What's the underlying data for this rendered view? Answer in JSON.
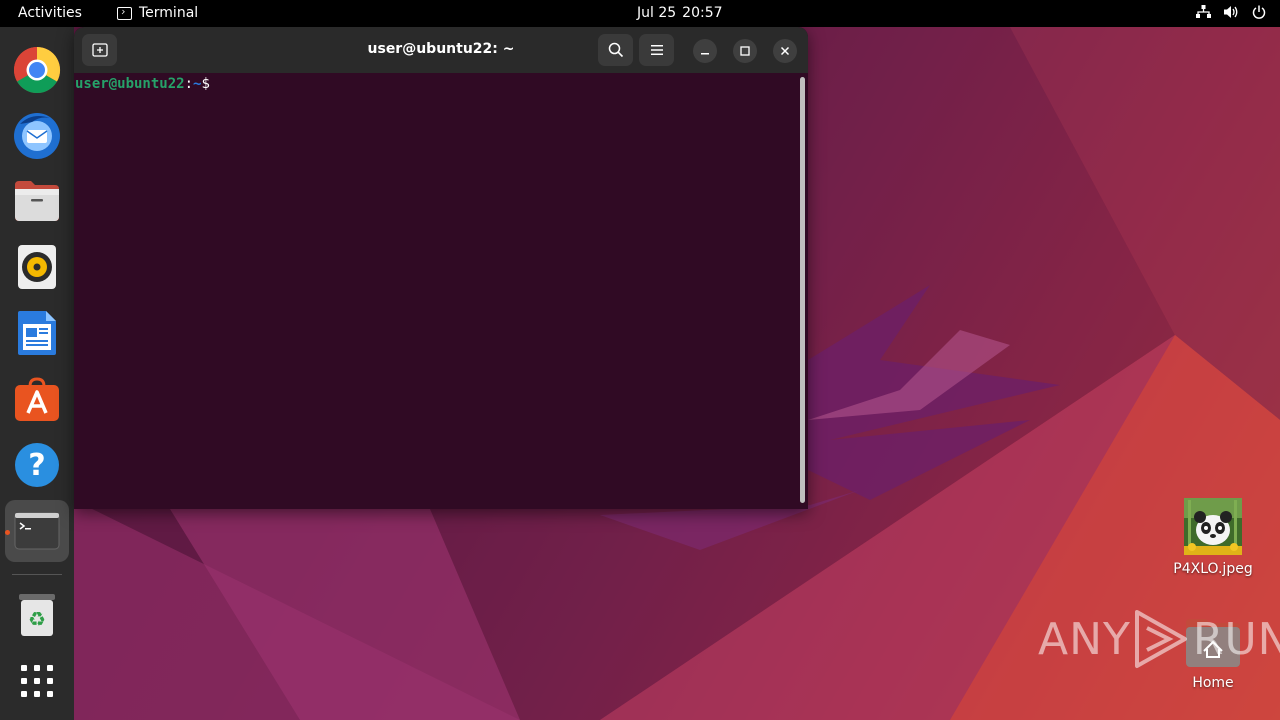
{
  "topbar": {
    "activities": "Activities",
    "app_name": "Terminal",
    "date": "Jul 25",
    "time": "20:57",
    "tray_icons": [
      "network-icon",
      "volume-icon",
      "power-icon"
    ]
  },
  "dock": {
    "items": [
      {
        "name": "chrome",
        "icon": "chrome-icon"
      },
      {
        "name": "thunderbird",
        "icon": "thunderbird-icon"
      },
      {
        "name": "files",
        "icon": "files-icon"
      },
      {
        "name": "rhythmbox",
        "icon": "rhythmbox-icon"
      },
      {
        "name": "writer",
        "icon": "writer-icon"
      },
      {
        "name": "app-center",
        "icon": "app-center-icon"
      },
      {
        "name": "help",
        "icon": "help-icon"
      },
      {
        "name": "terminal",
        "icon": "terminal-icon",
        "active": true
      },
      {
        "name": "trash",
        "icon": "trash-icon"
      },
      {
        "name": "show-apps",
        "icon": "grid-icon"
      }
    ]
  },
  "terminal": {
    "title": "user@ubuntu22: ~",
    "prompt_user": "user@ubuntu22",
    "prompt_colon": ":",
    "prompt_path": "~",
    "prompt_dollar": "$"
  },
  "desktop": {
    "files": [
      {
        "label": "P4XLO.jpeg",
        "icon": "image-thumbnail-icon"
      },
      {
        "label": "Home",
        "icon": "home-folder-icon"
      }
    ]
  },
  "watermark": {
    "left": "ANY",
    "right": "RUN"
  },
  "colors": {
    "accent": "#e95420",
    "terminal_bg": "#300a24",
    "prompt_user": "#26a269",
    "prompt_path": "#2a7bde"
  }
}
